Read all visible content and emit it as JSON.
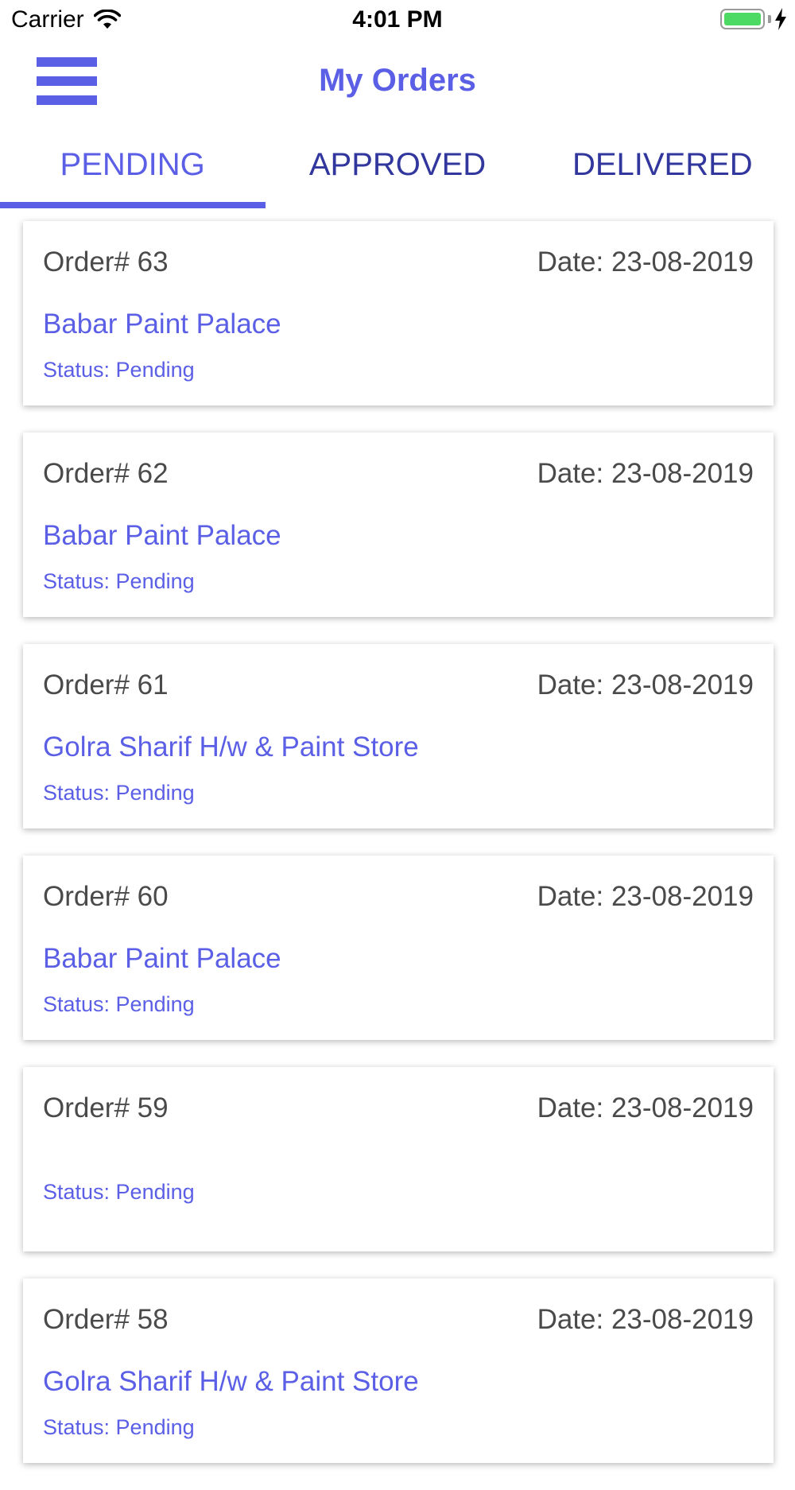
{
  "status_bar": {
    "carrier": "Carrier",
    "time": "4:01 PM",
    "battery_level": 1.0,
    "battery_color": "#4cd964",
    "icons": [
      "wifi-icon",
      "battery-icon",
      "charging-bolt-icon"
    ]
  },
  "header": {
    "title": "My Orders",
    "menu_icon": "hamburger-menu-icon"
  },
  "tabs": [
    {
      "label": "PENDING",
      "active": true
    },
    {
      "label": "APPROVED",
      "active": false
    },
    {
      "label": "DELIVERED",
      "active": false
    }
  ],
  "colors": {
    "accent": "#5b5fe6",
    "tab_inactive": "#32379e",
    "text_dark": "#4a4a4a"
  },
  "orders": [
    {
      "number": "Order# 63",
      "date": "Date: 23-08-2019",
      "store": "Babar Paint Palace",
      "status": "Status: Pending"
    },
    {
      "number": "Order# 62",
      "date": "Date: 23-08-2019",
      "store": "Babar Paint Palace",
      "status": "Status: Pending"
    },
    {
      "number": "Order# 61",
      "date": "Date: 23-08-2019",
      "store": "Golra Sharif H/w & Paint Store",
      "status": "Status: Pending"
    },
    {
      "number": "Order# 60",
      "date": "Date: 23-08-2019",
      "store": "Babar Paint Palace",
      "status": "Status: Pending"
    },
    {
      "number": "Order# 59",
      "date": "Date: 23-08-2019",
      "store": "",
      "status": "Status: Pending"
    },
    {
      "number": "Order# 58",
      "date": "Date: 23-08-2019",
      "store": "Golra Sharif H/w & Paint Store",
      "status": "Status: Pending"
    }
  ]
}
